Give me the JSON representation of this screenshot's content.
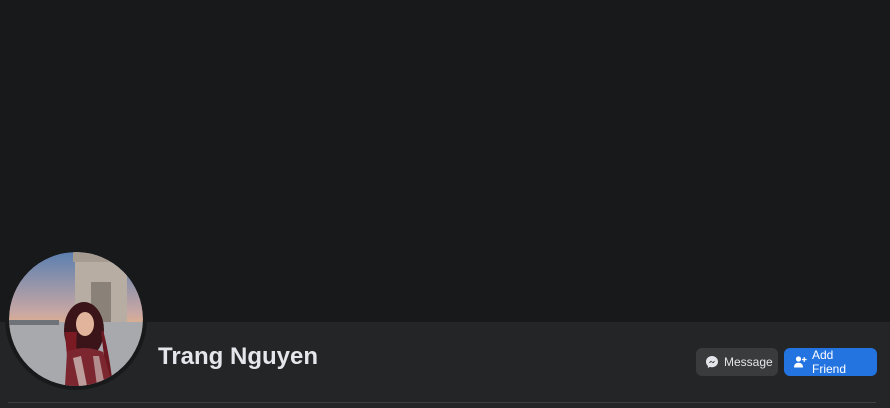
{
  "profile": {
    "name": "Trang Nguyen"
  },
  "actions": {
    "message_label": "Message",
    "add_friend_label": "Add Friend"
  },
  "colors": {
    "background": "#18191a",
    "panel": "#242526",
    "secondary_button": "#3a3b3c",
    "primary_button": "#2374e1",
    "text": "#e4e6eb"
  },
  "icons": {
    "message": "messenger-icon",
    "add_friend": "add-friend-icon"
  }
}
